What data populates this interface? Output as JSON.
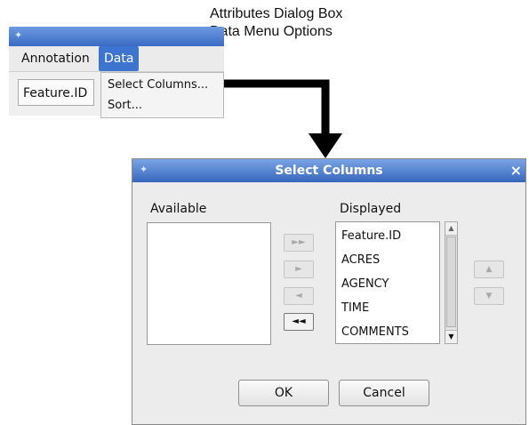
{
  "callout": {
    "line1": "Attributes Dialog Box",
    "line2": "Data Menu Options"
  },
  "attributes_window": {
    "icon": "window-icon",
    "menu": [
      {
        "label": "Annotation"
      },
      {
        "label": "Data"
      }
    ],
    "cell": "Feature.ID",
    "data_menu": [
      {
        "label": "Select Columns..."
      },
      {
        "label": "Sort..."
      }
    ]
  },
  "select_columns": {
    "title": "Select Columns",
    "close": "×",
    "available_label": "Available",
    "displayed_label": "Displayed",
    "available_items": [],
    "displayed_items": [
      "Feature.ID",
      "ACRES",
      "AGENCY",
      "TIME",
      "COMMENTS"
    ],
    "move_buttons": [
      {
        "icon": "add-all-icon",
        "glyph": "►►"
      },
      {
        "icon": "add-icon",
        "glyph": "►"
      },
      {
        "icon": "remove-icon",
        "glyph": "◄"
      },
      {
        "icon": "remove-all-icon",
        "glyph": "◄◄"
      }
    ],
    "order_buttons": [
      {
        "icon": "move-up-icon",
        "glyph": "▲"
      },
      {
        "icon": "move-down-icon",
        "glyph": "▼"
      }
    ],
    "ok_label": "OK",
    "cancel_label": "Cancel"
  },
  "colors": {
    "titlebar": "#3767bd",
    "menu_highlight": "#3d74cf",
    "dialog_bg": "#ececec"
  }
}
